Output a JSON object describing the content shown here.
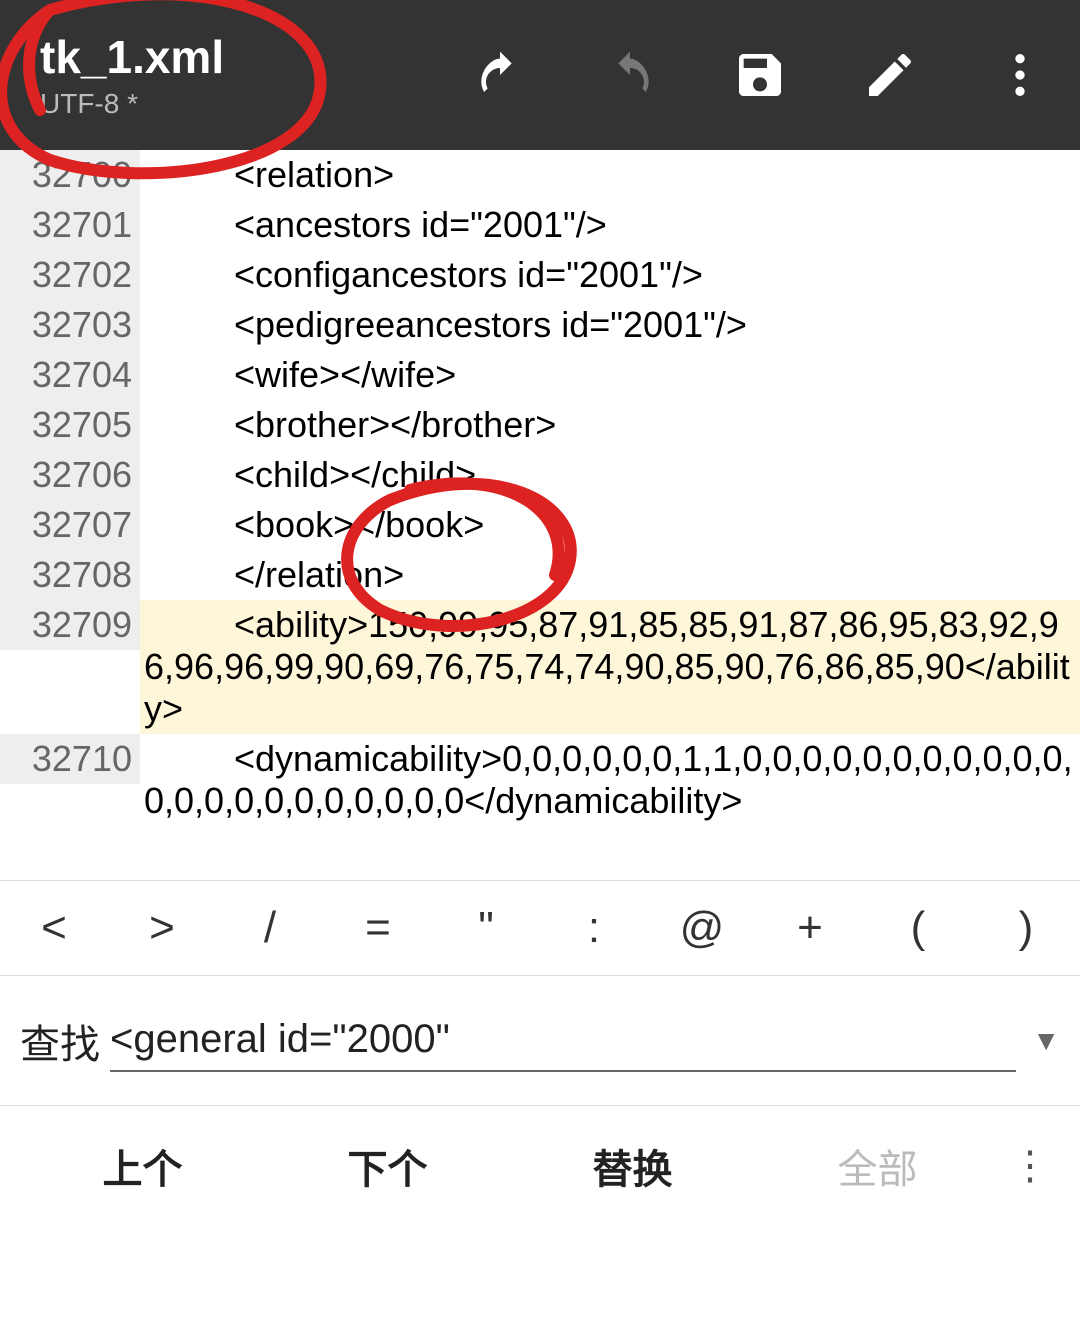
{
  "header": {
    "filename": "tk_1.xml",
    "encoding": "UTF-8 *"
  },
  "lines": [
    {
      "num": "32700",
      "indent": true,
      "text": "<relation>"
    },
    {
      "num": "32701",
      "indent": true,
      "text": "<ancestors id=\"2001\"/>"
    },
    {
      "num": "32702",
      "indent": true,
      "text": "<configancestors id=\"2001\"/>"
    },
    {
      "num": "32703",
      "indent": true,
      "text": "<pedigreeancestors id=\"2001\"/>"
    },
    {
      "num": "32704",
      "indent": true,
      "text": "<wife></wife>"
    },
    {
      "num": "32705",
      "indent": true,
      "text": "<brother></brother>"
    },
    {
      "num": "32706",
      "indent": true,
      "text": "<child></child>"
    },
    {
      "num": "32707",
      "indent": true,
      "text": "<book></book>"
    },
    {
      "num": "32708",
      "indent": true,
      "text": "</relation>"
    },
    {
      "num": "32709",
      "indent": true,
      "hl": true,
      "text": "<ability>150,99,95,87,91,85,85,91,87,86,95,83,92,96,96,96,99,90,69,76,75,74,74,90,85,90,76,86,85,90</ability>"
    },
    {
      "num": "32710",
      "indent": true,
      "text": "<dynamicability>0,0,0,0,0,0,1,1,0,0,0,0,0,0,0,0,0,0,0,0,0,0,0,0,0,0,0,0,0,0</dynamicability>"
    }
  ],
  "symbols": [
    "<",
    ">",
    "/",
    "=",
    "\"",
    ":",
    "@",
    "+",
    "(",
    ")"
  ],
  "search": {
    "label": "查找",
    "value": "<general id=\"2000\""
  },
  "actions": {
    "prev": "上个",
    "next": "下个",
    "replace": "替换",
    "all": "全部"
  }
}
